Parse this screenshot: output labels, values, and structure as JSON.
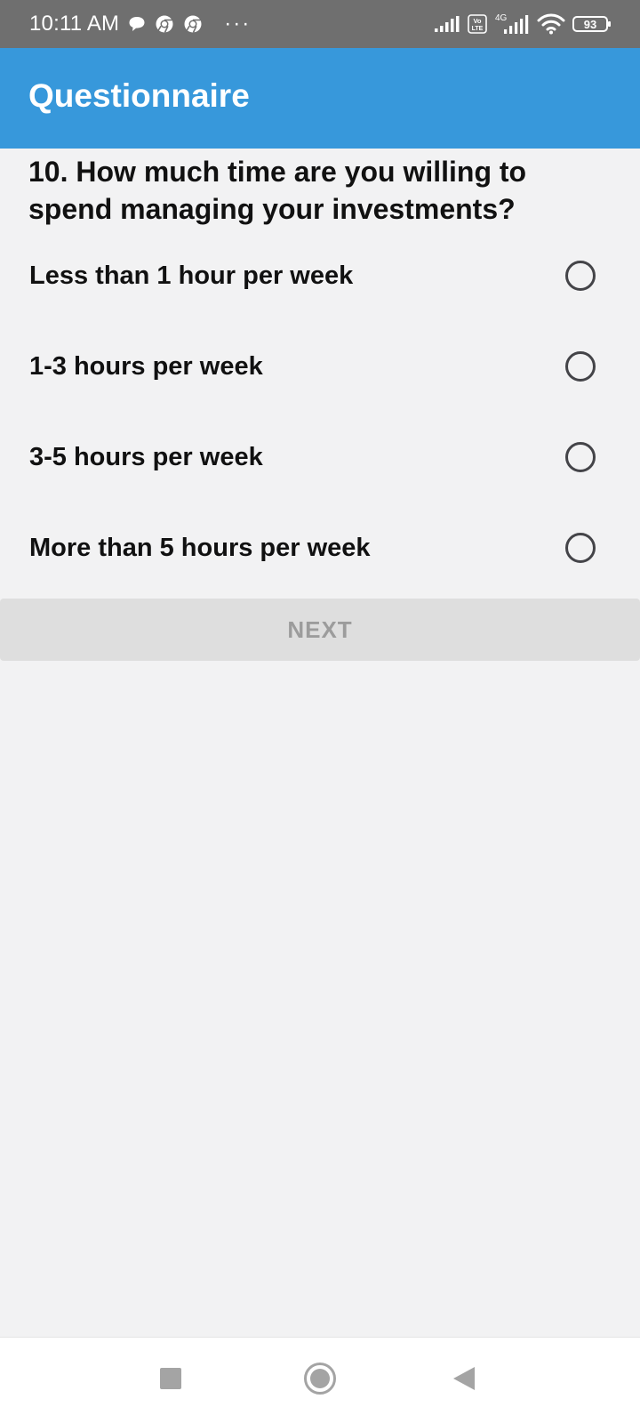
{
  "status_bar": {
    "time": "10:11 AM",
    "more": "···",
    "battery": "93",
    "icons": [
      "chat-bubble-icon",
      "chrome-icon",
      "chrome-icon",
      "signal-icon",
      "volte-icon",
      "signal-4g-icon",
      "wifi-icon",
      "battery-icon"
    ],
    "network": "4G",
    "volte": "Vo LTE"
  },
  "app_bar": {
    "title": "Questionnaire",
    "color": "#3798db"
  },
  "question": {
    "text": "10. How much time are you willing to spend managing your investments?"
  },
  "options": [
    {
      "label": "Less than 1 hour per week",
      "selected": false
    },
    {
      "label": "1-3 hours per week",
      "selected": false
    },
    {
      "label": "3-5 hours per week",
      "selected": false
    },
    {
      "label": "More than 5 hours per week",
      "selected": false
    }
  ],
  "next_button": {
    "label": "NEXT",
    "enabled": false
  },
  "nav_bar": {
    "icons": [
      "recents-square-icon",
      "home-circle-icon",
      "back-triangle-icon"
    ]
  }
}
